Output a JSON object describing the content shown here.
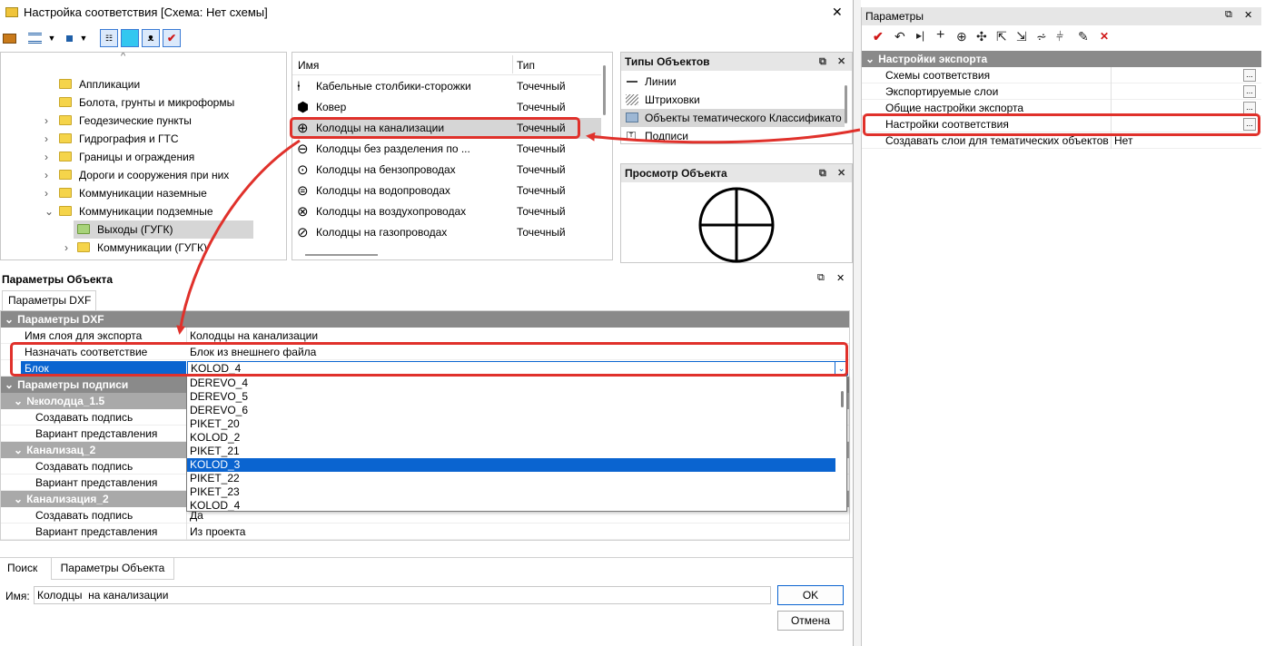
{
  "main_window": {
    "title": "Настройка соответствия [Схема: Нет схемы]",
    "close": "✕"
  },
  "tree": {
    "items": [
      {
        "label": "Аппликации",
        "expander": ""
      },
      {
        "label": "Болота, грунты и микроформы",
        "expander": ""
      },
      {
        "label": "Геодезические пункты",
        "expander": "›"
      },
      {
        "label": "Гидрография и ГТС",
        "expander": "›"
      },
      {
        "label": "Границы и ограждения",
        "expander": "›"
      },
      {
        "label": "Дороги и сооружения при них",
        "expander": "›"
      },
      {
        "label": "Коммуникации наземные",
        "expander": "›"
      },
      {
        "label": "Коммуникации подземные",
        "expander": "⌄"
      },
      {
        "label": "Выходы (ГУГК)",
        "expander": ""
      },
      {
        "label": "Коммуникации (ГУГК)",
        "expander": "›"
      }
    ]
  },
  "objects": {
    "col_name": "Имя",
    "col_type": "Тип",
    "rows": [
      {
        "name": "Кабельные столбики-сторожки",
        "type": "Точечный"
      },
      {
        "name": "Ковер",
        "type": "Точечный"
      },
      {
        "name": "Колодцы  на канализации",
        "type": "Точечный"
      },
      {
        "name": "Колодцы без разделения по ...",
        "type": "Точечный"
      },
      {
        "name": "Колодцы на бензопроводах",
        "type": "Точечный"
      },
      {
        "name": "Колодцы на водопроводах",
        "type": "Точечный"
      },
      {
        "name": "Колодцы на воздухопроводах",
        "type": "Точечный"
      },
      {
        "name": "Колодцы на газопроводах",
        "type": "Точечный"
      }
    ]
  },
  "types_panel": {
    "title": "Типы Объектов",
    "items": [
      "Линии",
      "Штриховки",
      "Объекты тематического Классификато",
      "Подписи"
    ]
  },
  "preview_panel": {
    "title": "Просмотр Объекта"
  },
  "obj_params": {
    "title": "Параметры Объекта",
    "tab": "Параметры DXF",
    "group_dxf": "Параметры DXF",
    "layer_label": "Имя слоя для экспорта",
    "layer_value": "Колодцы  на канализации",
    "assign_label": "Назначать соответствие",
    "assign_value": "Блок из внешнего файла",
    "block_label": "Блок",
    "block_value": "KOLOD_4",
    "group_labels": "Параметры подписи",
    "sub1": "№колодца_1.5",
    "sub2": "Канализац_2",
    "sub3": "Канализация_2",
    "create_label": "Создавать подпись",
    "variant_label": "Вариант представления",
    "create_value_last": "Да",
    "variant_value_last": "Из проекта"
  },
  "dropdown": {
    "options": [
      "DEREVO_4",
      "DEREVO_5",
      "DEREVO_6",
      "PIKET_20",
      "KOLOD_2",
      "PIKET_21",
      "KOLOD_3",
      "PIKET_22",
      "PIKET_23",
      "KOLOD_4"
    ],
    "highlighted": "KOLOD_3"
  },
  "bottom": {
    "tab_search": "Поиск",
    "tab_params": "Параметры Объекта",
    "name_label": "Имя:",
    "name_value": "Колодцы  на канализации",
    "ok": "OK",
    "cancel": "Отмена"
  },
  "params": {
    "title": "Параметры",
    "group": "Настройки экспорта",
    "rows": [
      {
        "label": "Схемы соответствия",
        "value": ""
      },
      {
        "label": "Экспортируемые слои",
        "value": ""
      },
      {
        "label": "Общие настройки экспорта",
        "value": ""
      },
      {
        "label": "Настройки соответствия",
        "value": ""
      },
      {
        "label": "Создавать слои для тематических объектов",
        "value": "Нет"
      }
    ],
    "ellipsis": "..."
  },
  "colors": {
    "annotation": "#e0312b",
    "selection": "#0078d7",
    "group_header": "#8a8a8a"
  }
}
